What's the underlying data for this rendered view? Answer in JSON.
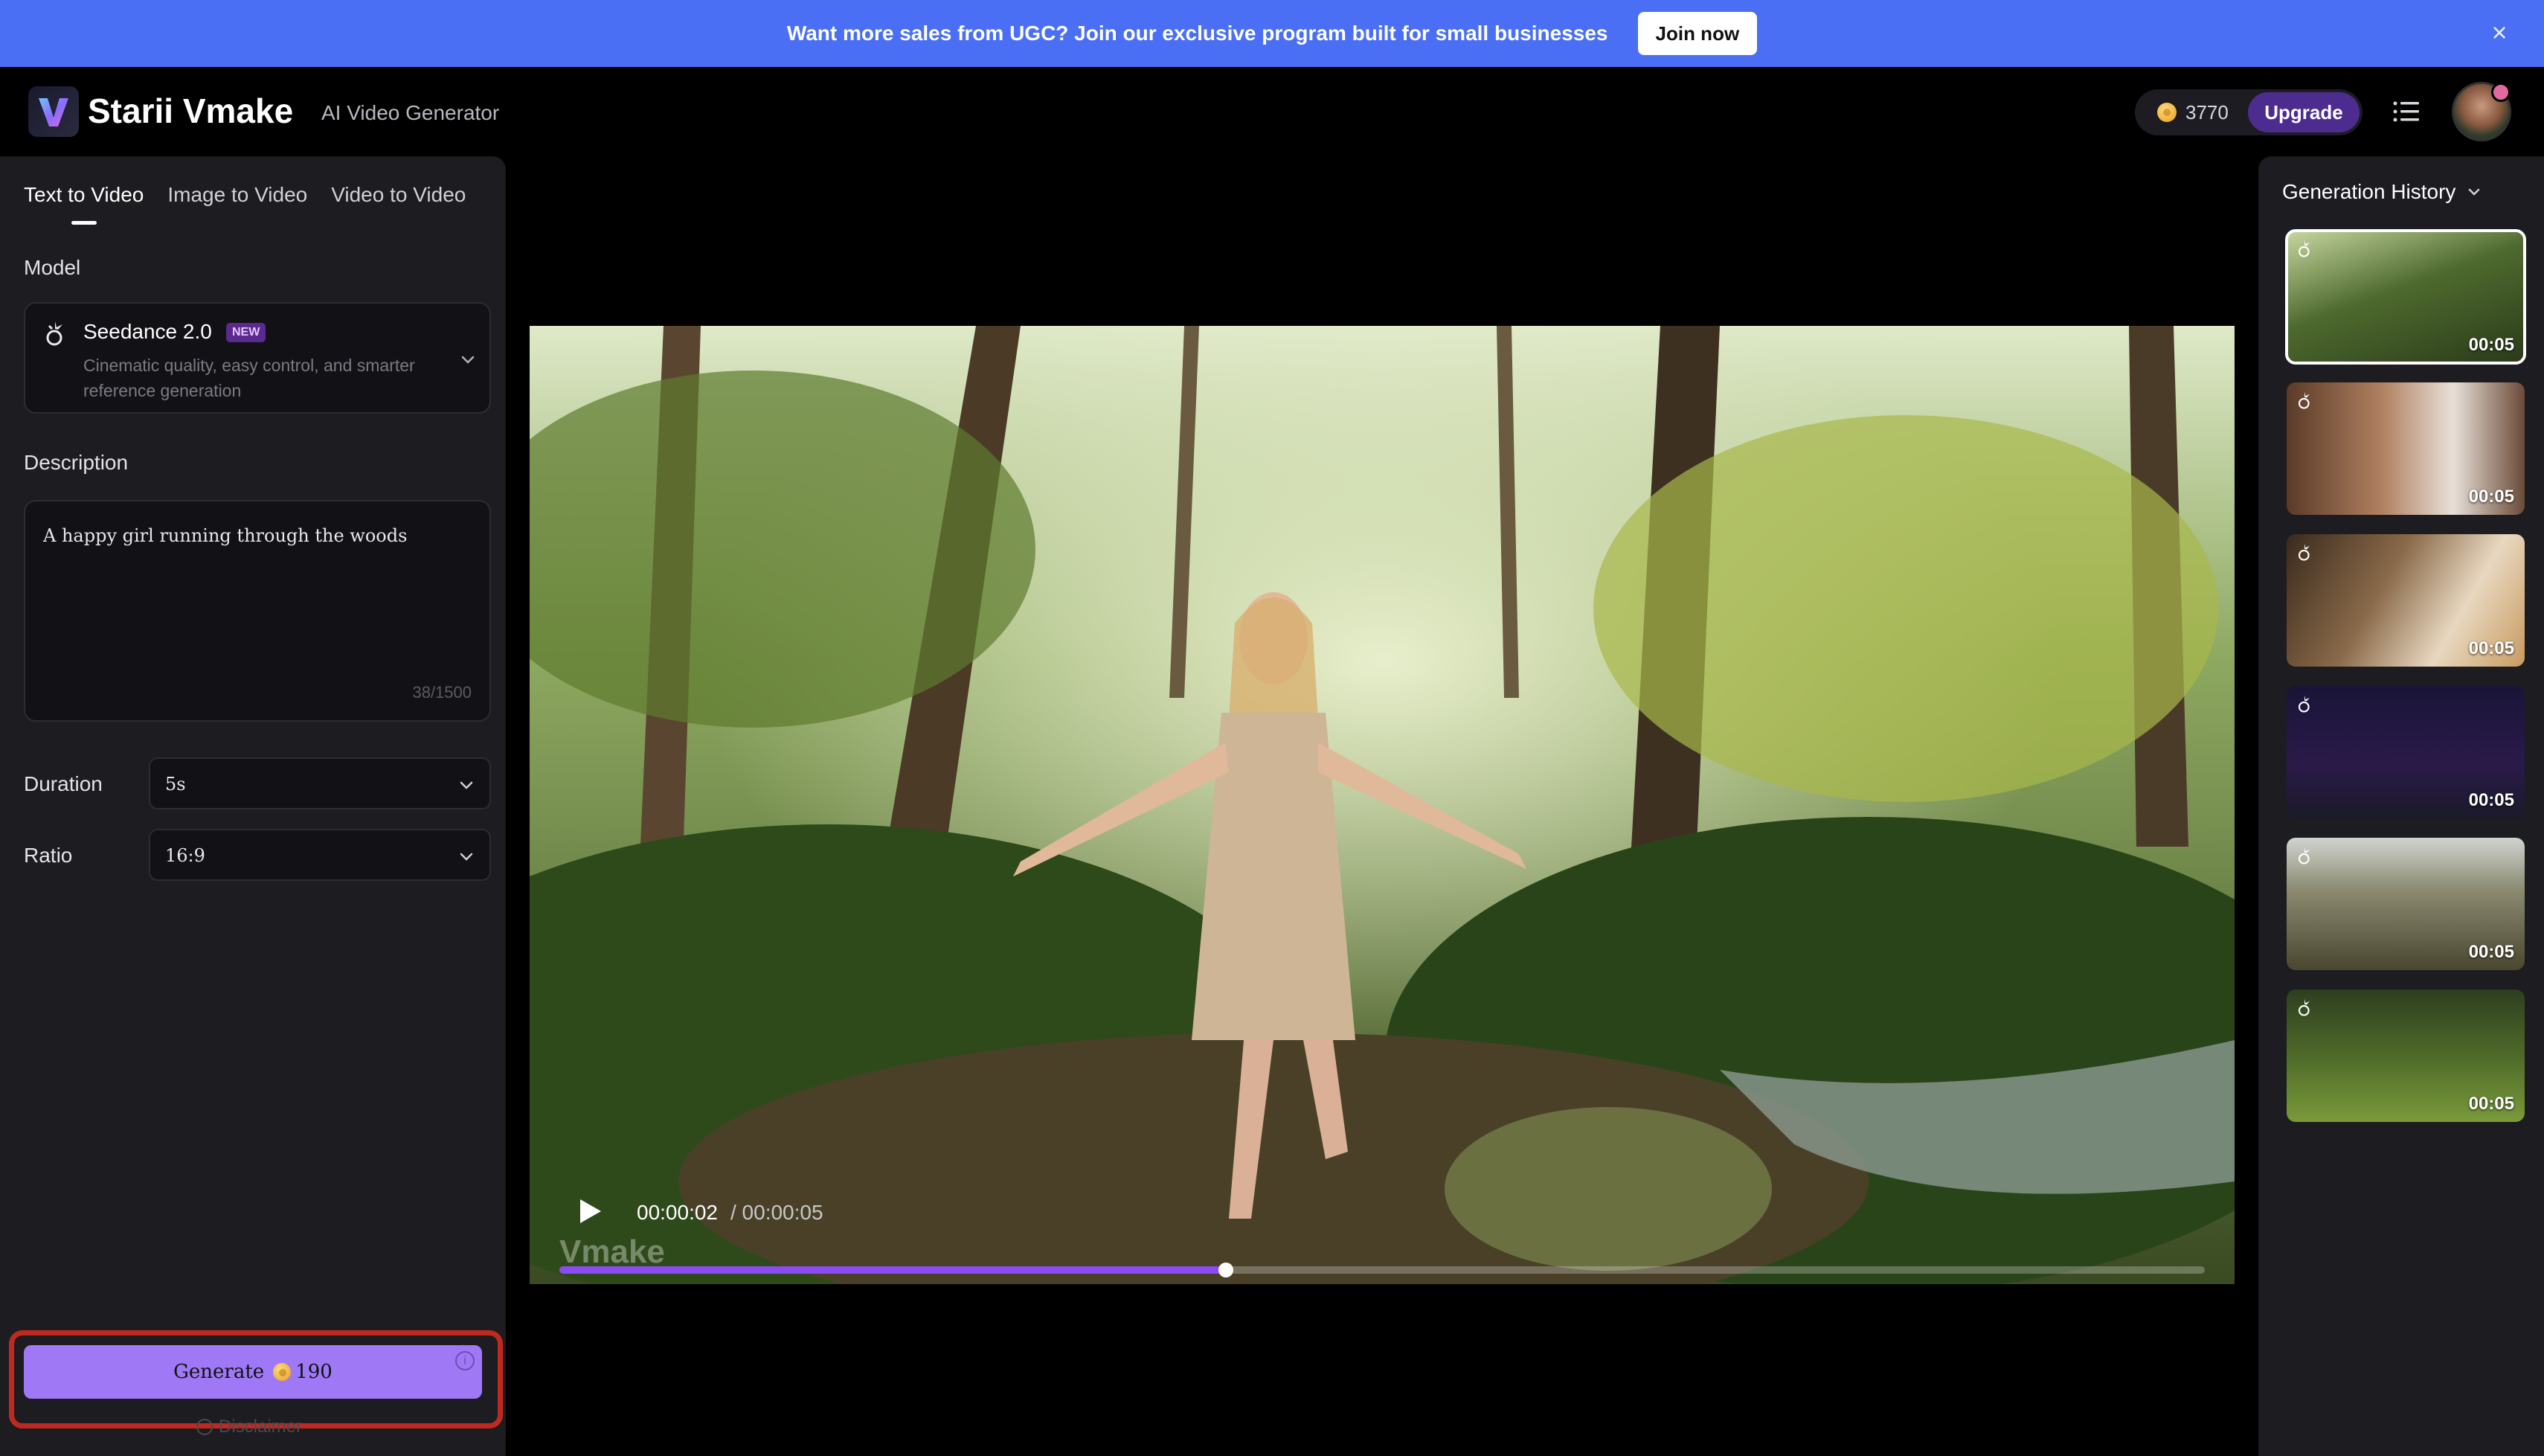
{
  "banner": {
    "text": "Want more sales from UGC? Join our exclusive program built for small businesses",
    "cta": "Join now",
    "close_icon": "close-icon"
  },
  "header": {
    "brand": "Starii Vmake",
    "subtitle": "AI Video Generator",
    "credits": "3770",
    "upgrade": "Upgrade",
    "menu_icon": "list-icon"
  },
  "left_panel": {
    "tabs": [
      {
        "label": "Text to Video",
        "active": true
      },
      {
        "label": "Image to Video",
        "active": false
      },
      {
        "label": "Video to Video",
        "active": false
      }
    ],
    "model_label": "Model",
    "model": {
      "name": "Seedance 2.0",
      "badge": "NEW",
      "description": "Cinematic quality, easy control, and smarter reference generation"
    },
    "description_label": "Description",
    "description_value": "A happy girl running through the woods",
    "description_count": "38/1500",
    "duration_label": "Duration",
    "duration_value": "5s",
    "ratio_label": "Ratio",
    "ratio_value": "16:9",
    "generate_label": "Generate",
    "generate_cost": "190",
    "disclaimer": "Disclaimer"
  },
  "player": {
    "current_time": "00:00:02",
    "total_time": "/ 00:00:05",
    "watermark": "Vmake",
    "progress": 0.405
  },
  "history": {
    "title": "Generation History",
    "items": [
      {
        "duration": "00:05",
        "scene": "forest-walk",
        "selected": true
      },
      {
        "duration": "00:05",
        "scene": "teapot-pour",
        "selected": false
      },
      {
        "duration": "00:05",
        "scene": "woman-drinking",
        "selected": false
      },
      {
        "duration": "00:05",
        "scene": "cartoon-girl-phone",
        "selected": false
      },
      {
        "duration": "00:05",
        "scene": "tall-grass",
        "selected": false
      },
      {
        "duration": "00:05",
        "scene": "cat-on-grass",
        "selected": false
      }
    ]
  },
  "colors": {
    "banner": "#4a6ff5",
    "panel": "#1c1c21",
    "accent": "#9f78f5",
    "progress": "#8a4cf0",
    "highlight_outline": "#c0291f"
  }
}
